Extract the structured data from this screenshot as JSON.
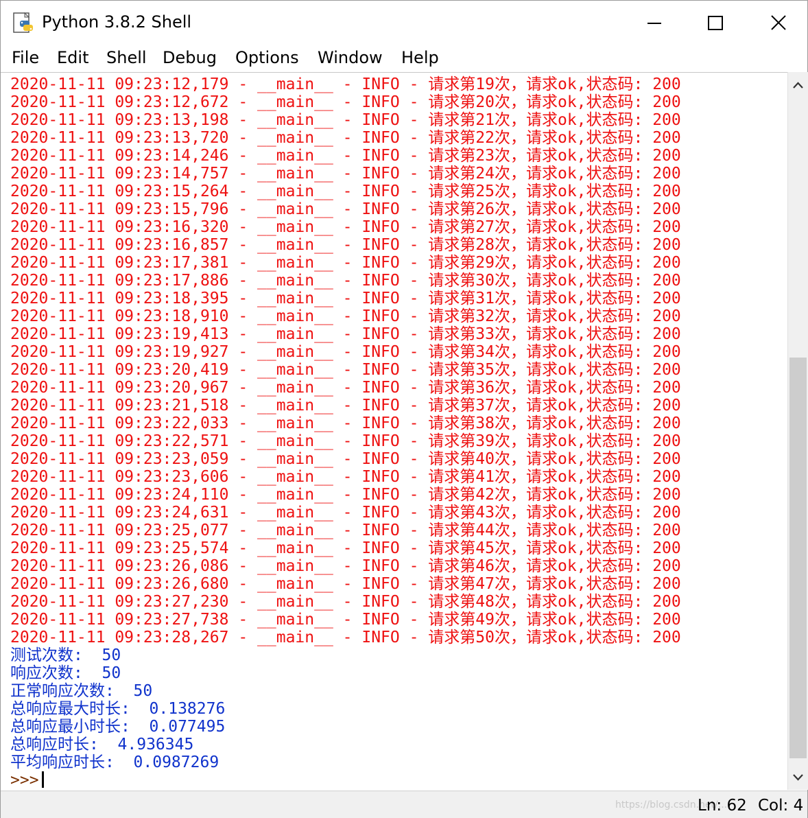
{
  "window": {
    "title": "Python 3.8.2 Shell",
    "icon": "python-idle-icon",
    "controls": {
      "minimize_icon": "minimize-icon",
      "maximize_icon": "maximize-icon",
      "close_icon": "close-icon"
    }
  },
  "menu": {
    "items": [
      "File",
      "Edit",
      "Shell",
      "Debug",
      "Options",
      "Window",
      "Help"
    ]
  },
  "colors": {
    "log_text": "#ee1111",
    "stat_text": "#1033cc",
    "prompt_text": "#7a3000",
    "scroll_thumb": "#cdcdcd"
  },
  "log_lines": [
    "2020-11-11 09:23:12,179 - __main__ - INFO - 请求第19次，请求ok,状态码: 200",
    "2020-11-11 09:23:12,672 - __main__ - INFO - 请求第20次，请求ok,状态码: 200",
    "2020-11-11 09:23:13,198 - __main__ - INFO - 请求第21次，请求ok,状态码: 200",
    "2020-11-11 09:23:13,720 - __main__ - INFO - 请求第22次，请求ok,状态码: 200",
    "2020-11-11 09:23:14,246 - __main__ - INFO - 请求第23次，请求ok,状态码: 200",
    "2020-11-11 09:23:14,757 - __main__ - INFO - 请求第24次，请求ok,状态码: 200",
    "2020-11-11 09:23:15,264 - __main__ - INFO - 请求第25次，请求ok,状态码: 200",
    "2020-11-11 09:23:15,796 - __main__ - INFO - 请求第26次，请求ok,状态码: 200",
    "2020-11-11 09:23:16,320 - __main__ - INFO - 请求第27次，请求ok,状态码: 200",
    "2020-11-11 09:23:16,857 - __main__ - INFO - 请求第28次，请求ok,状态码: 200",
    "2020-11-11 09:23:17,381 - __main__ - INFO - 请求第29次，请求ok,状态码: 200",
    "2020-11-11 09:23:17,886 - __main__ - INFO - 请求第30次，请求ok,状态码: 200",
    "2020-11-11 09:23:18,395 - __main__ - INFO - 请求第31次，请求ok,状态码: 200",
    "2020-11-11 09:23:18,910 - __main__ - INFO - 请求第32次，请求ok,状态码: 200",
    "2020-11-11 09:23:19,413 - __main__ - INFO - 请求第33次，请求ok,状态码: 200",
    "2020-11-11 09:23:19,927 - __main__ - INFO - 请求第34次，请求ok,状态码: 200",
    "2020-11-11 09:23:20,419 - __main__ - INFO - 请求第35次，请求ok,状态码: 200",
    "2020-11-11 09:23:20,967 - __main__ - INFO - 请求第36次，请求ok,状态码: 200",
    "2020-11-11 09:23:21,518 - __main__ - INFO - 请求第37次，请求ok,状态码: 200",
    "2020-11-11 09:23:22,033 - __main__ - INFO - 请求第38次，请求ok,状态码: 200",
    "2020-11-11 09:23:22,571 - __main__ - INFO - 请求第39次，请求ok,状态码: 200",
    "2020-11-11 09:23:23,059 - __main__ - INFO - 请求第40次，请求ok,状态码: 200",
    "2020-11-11 09:23:23,606 - __main__ - INFO - 请求第41次，请求ok,状态码: 200",
    "2020-11-11 09:23:24,110 - __main__ - INFO - 请求第42次，请求ok,状态码: 200",
    "2020-11-11 09:23:24,631 - __main__ - INFO - 请求第43次，请求ok,状态码: 200",
    "2020-11-11 09:23:25,077 - __main__ - INFO - 请求第44次，请求ok,状态码: 200",
    "2020-11-11 09:23:25,574 - __main__ - INFO - 请求第45次，请求ok,状态码: 200",
    "2020-11-11 09:23:26,086 - __main__ - INFO - 请求第46次，请求ok,状态码: 200",
    "2020-11-11 09:23:26,680 - __main__ - INFO - 请求第47次，请求ok,状态码: 200",
    "2020-11-11 09:23:27,230 - __main__ - INFO - 请求第48次，请求ok,状态码: 200",
    "2020-11-11 09:23:27,738 - __main__ - INFO - 请求第49次，请求ok,状态码: 200",
    "2020-11-11 09:23:28,267 - __main__ - INFO - 请求第50次，请求ok,状态码: 200"
  ],
  "stats": [
    "测试次数:  50",
    "响应次数:  50",
    "正常响应次数:  50",
    "总响应最大时长:  0.138276",
    "总响应最小时长:  0.077495",
    "总响应时长:  4.936345",
    "平均响应时长:  0.0987269"
  ],
  "prompt": ">>>",
  "scrollbar": {
    "up_icon": "chevron-up-icon",
    "down_icon": "chevron-down-icon",
    "thumb_start_fraction": 0.39,
    "thumb_visible_fraction": 0.6
  },
  "status": {
    "watermark": "https://blog.csdn.net/...",
    "line": "Ln: 62",
    "col": "Col: 4"
  }
}
